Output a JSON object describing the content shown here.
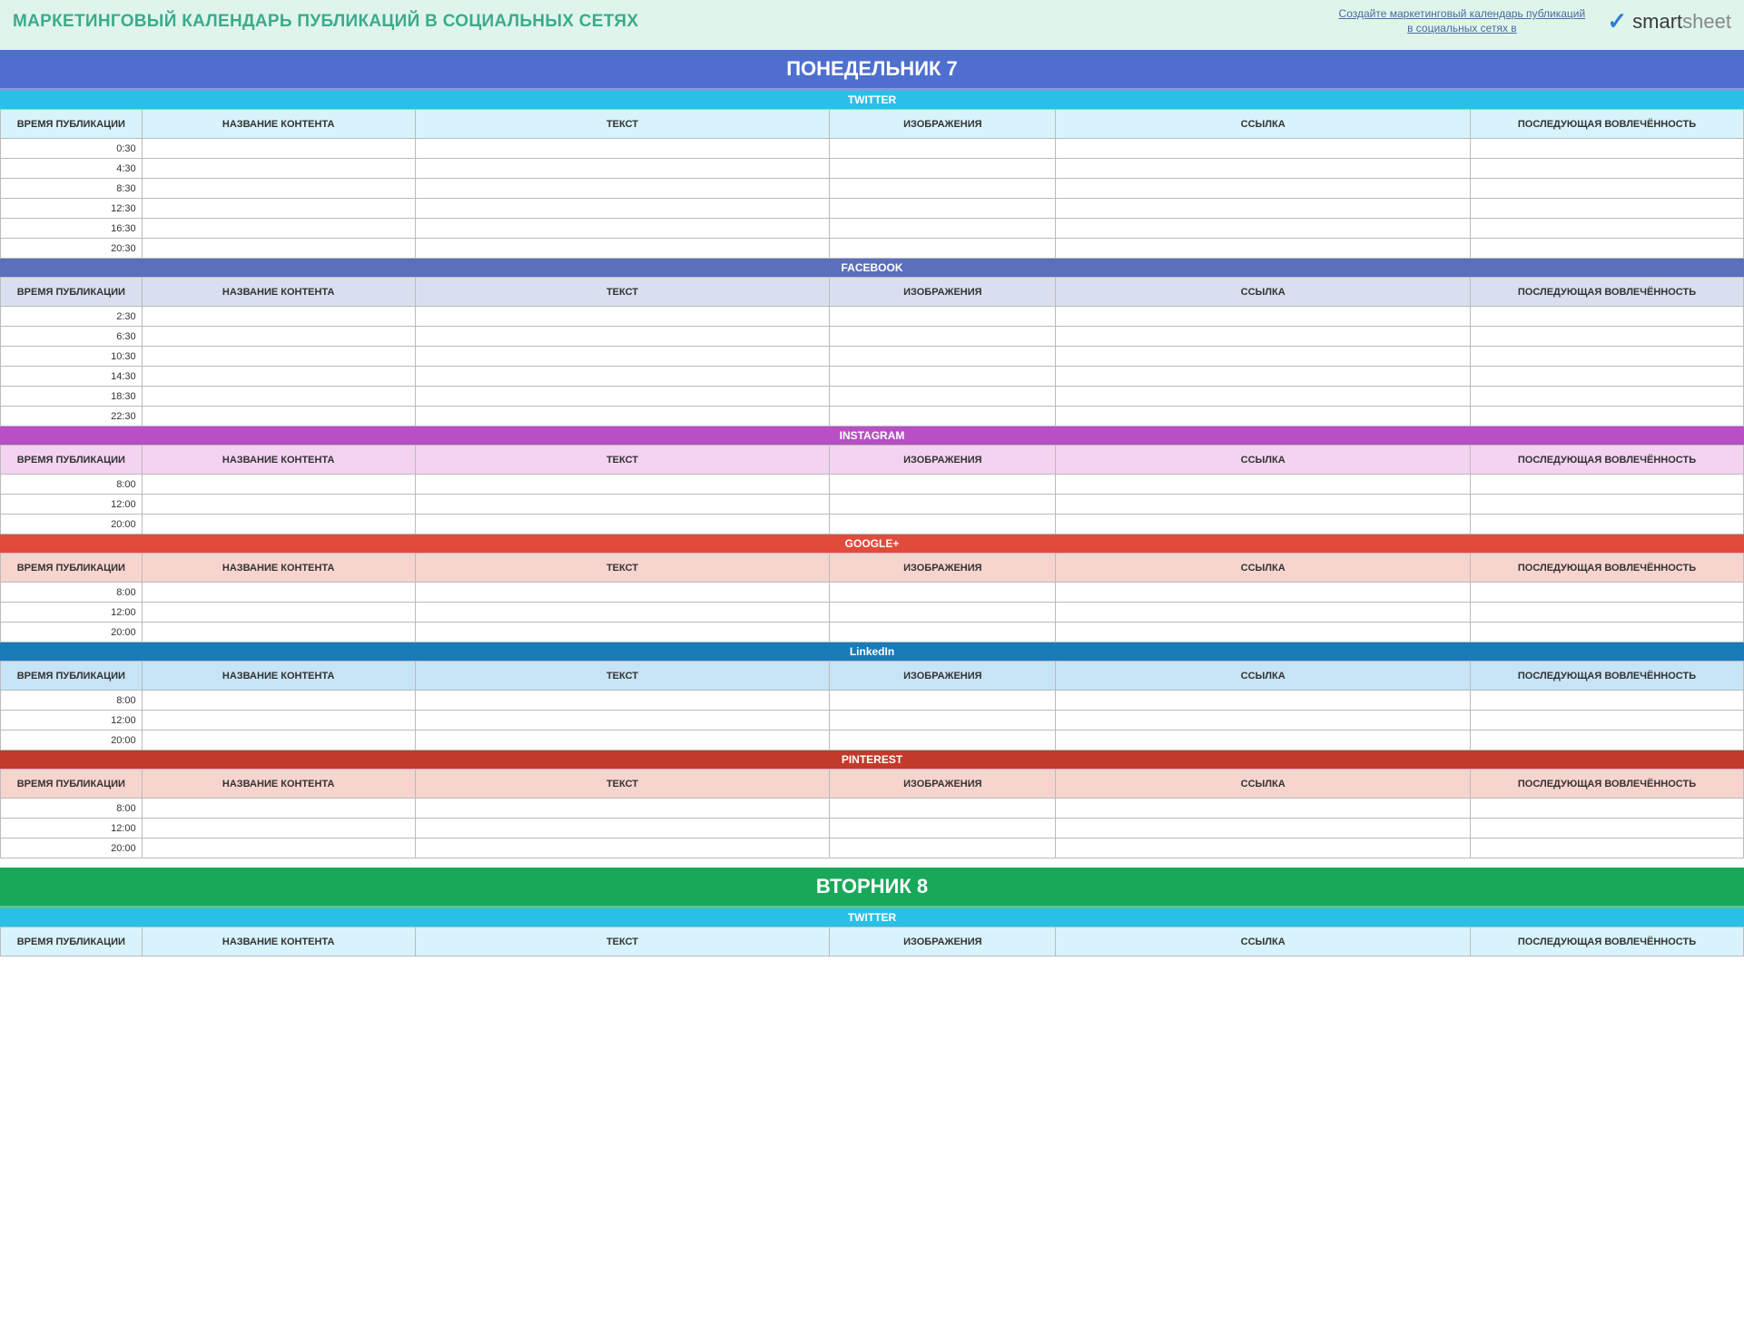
{
  "header": {
    "title": "МАРКЕТИНГОВЫЙ КАЛЕНДАРЬ ПУБЛИКАЦИЙ В СОЦИАЛЬНЫХ СЕТЯХ",
    "link_text": "Создайте маркетинговый календарь публикаций в социальных сетях в",
    "logo_brand1": "smart",
    "logo_brand2": "sheet"
  },
  "columns": {
    "time": "ВРЕМЯ ПУБЛИКАЦИИ",
    "content_title": "НАЗВАНИЕ КОНТЕНТА",
    "text": "ТЕКСТ",
    "images": "ИЗОБРАЖЕНИЯ",
    "link": "ССЫЛКА",
    "engagement": "ПОСЛЕДУЮЩАЯ ВОВЛЕЧЁННОСТЬ"
  },
  "days": [
    {
      "label": "ПОНЕДЕЛЬНИК   7",
      "class": "monday",
      "platforms": [
        {
          "name": "TWITTER",
          "class": "twitter",
          "rows": [
            "0:30",
            "4:30",
            "8:30",
            "12:30",
            "16:30",
            "20:30"
          ]
        },
        {
          "name": "FACEBOOK",
          "class": "facebook",
          "rows": [
            "2:30",
            "6:30",
            "10:30",
            "14:30",
            "18:30",
            "22:30"
          ]
        },
        {
          "name": "INSTAGRAM",
          "class": "instagram",
          "rows": [
            "8:00",
            "12:00",
            "20:00"
          ]
        },
        {
          "name": "GOOGLE+",
          "class": "google",
          "rows": [
            "8:00",
            "12:00",
            "20:00"
          ]
        },
        {
          "name": "LinkedIn",
          "class": "linkedin",
          "rows": [
            "8:00",
            "12:00",
            "20:00"
          ]
        },
        {
          "name": "PINTEREST",
          "class": "pinterest",
          "rows": [
            "8:00",
            "12:00",
            "20:00"
          ]
        }
      ]
    },
    {
      "label": "ВТОРНИК   8",
      "class": "tuesday",
      "platforms": [
        {
          "name": "TWITTER",
          "class": "twitter",
          "rows": []
        }
      ]
    }
  ]
}
